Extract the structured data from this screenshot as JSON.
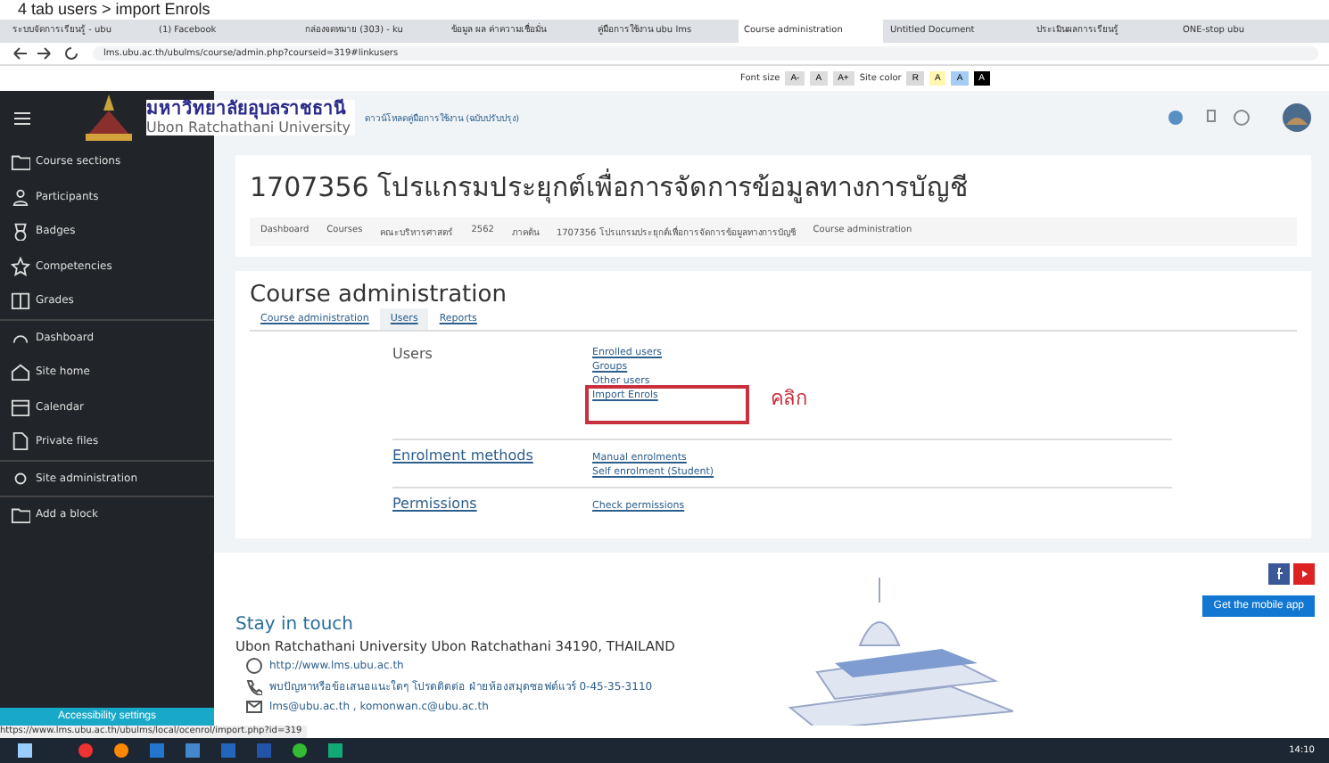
{
  "caption": "4 tab users > import Enrols",
  "browser_tabs": [
    {
      "title": "ระบบจัดการเรียนรู้ - ubu",
      "selected": false
    },
    {
      "title": "(1) Facebook",
      "selected": false
    },
    {
      "title": "กล่องจดหมาย (303) - ku",
      "selected": false
    },
    {
      "title": "ข้อมูล ผล ค่าความเชื่อมั่น",
      "selected": false
    },
    {
      "title": "คู่มือการใช้งาน ubu lms",
      "selected": false
    },
    {
      "title": "Course administration",
      "selected": true
    },
    {
      "title": "Untitled Document",
      "selected": false
    },
    {
      "title": "ประเมินผลการเรียนรู้",
      "selected": false
    },
    {
      "title": "ONE-stop ubu",
      "selected": false
    }
  ],
  "address": "lms.ubu.ac.th/ubulms/course/admin.php?courseid=319#linkusers",
  "accessibility_bar": {
    "font_label": "Font size",
    "font_buttons": [
      "A-",
      "A",
      "A+"
    ],
    "color_label": "Site color",
    "color_buttons": [
      {
        "label": "R",
        "color": "#d9d9d9"
      },
      {
        "label": "A",
        "color": "#fff7b0"
      },
      {
        "label": "A",
        "color": "#a8cdf5"
      },
      {
        "label": "A",
        "color": "#000000"
      }
    ]
  },
  "header": {
    "logo_thai": "มหาวิทยาลัยอุบลราชธานี",
    "logo_english": "Ubon Ratchathani University",
    "notice": "ดาวน์โหลดคู่มือการใช้งาน (ฉบับปรับปรุง)"
  },
  "sidebar": {
    "items": [
      {
        "label": "Course sections",
        "kind": "folder"
      },
      {
        "label": "Participants",
        "kind": "people"
      },
      {
        "label": "Badges",
        "kind": "badge"
      },
      {
        "label": "Competencies",
        "kind": "star"
      },
      {
        "label": "Grades",
        "kind": "table"
      },
      {
        "label": "Dashboard",
        "kind": "gauge"
      },
      {
        "label": "Site home",
        "kind": "home"
      },
      {
        "label": "Calendar",
        "kind": "calendar"
      },
      {
        "label": "Private files",
        "kind": "file"
      },
      {
        "label": "Site administration",
        "kind": "gear"
      },
      {
        "label": "Add a block",
        "kind": "folder"
      }
    ],
    "accessibility": "Accessibility settings"
  },
  "course": {
    "title": "1707356 โปรแกรมประยุกต์เพื่อการจัดการข้อมูลทางการบัญชี",
    "breadcrumb": [
      "Dashboard",
      "Courses",
      "คณะบริหารศาสตร์",
      "2562",
      "ภาคต้น",
      "1707356 โปรแกรมประยุกต์เพื่อการจัดการข้อมูลทางการบัญชี",
      "Course administration"
    ]
  },
  "admin": {
    "title": "Course administration",
    "tabs": [
      {
        "label": "Course administration",
        "selected": false
      },
      {
        "label": "Users",
        "selected": true
      },
      {
        "label": "Reports",
        "selected": false
      }
    ],
    "sections": [
      {
        "heading": "Users",
        "linked": false,
        "links": [
          "Enrolled users",
          "Groups",
          "Other users",
          "Import Enrols"
        ]
      },
      {
        "heading": "Enrolment methods",
        "linked": true,
        "links": [
          "Manual enrolments",
          "Self enrolment (Student)"
        ]
      },
      {
        "heading": "Permissions",
        "linked": true,
        "links": [
          "Check permissions"
        ]
      }
    ],
    "callout": "คลิก"
  },
  "footer": {
    "title": "Stay in touch",
    "address": "Ubon Ratchathani University Ubon Ratchathani 34190, THAILAND",
    "website": "http://www.lms.ubu.ac.th",
    "phone": "พบปัญหาหรือข้อเสนอแนะใดๆ โปรดติดต่อ ฝ่ายห้องสมุดซอฟต์แวร์ 0-45-35-3110",
    "email": "lms@ubu.ac.th , komonwan.c@ubu.ac.th",
    "mobile_app": "Get the mobile app"
  },
  "status_url": "https://www.lms.ubu.ac.th/ubulms/local/ocenrol/import.php?id=319",
  "taskbar": {
    "clock": "14:10"
  }
}
